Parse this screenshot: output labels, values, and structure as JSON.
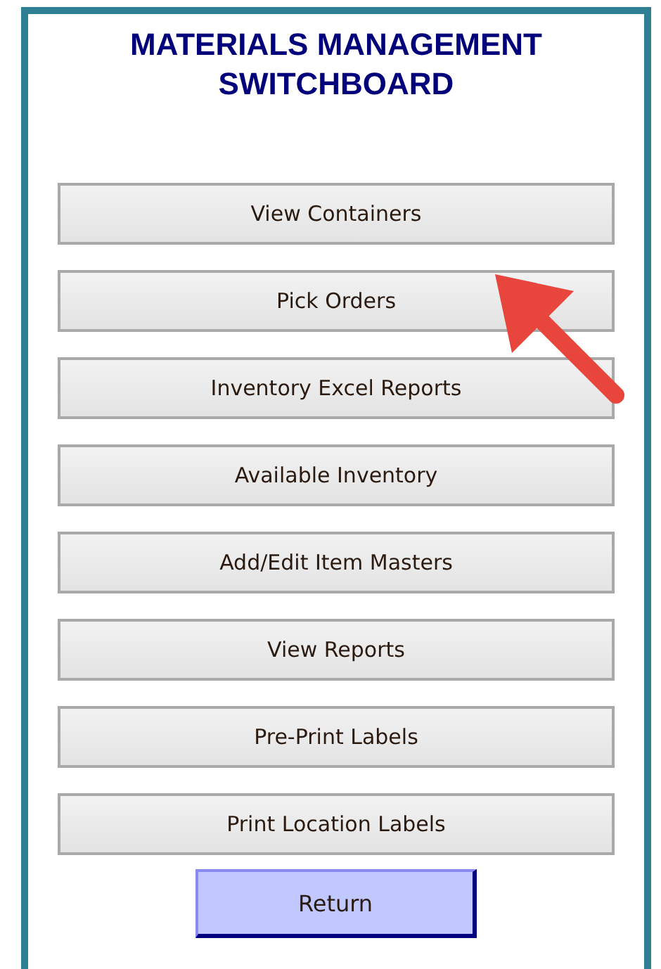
{
  "title": [
    "MATERIALS MANAGEMENT",
    "SWITCHBOARD"
  ],
  "buttons": [
    {
      "label": "View Containers"
    },
    {
      "label": "Pick Orders"
    },
    {
      "label": "Inventory Excel Reports"
    },
    {
      "label": "Available Inventory"
    },
    {
      "label": "Add/Edit Item Masters"
    },
    {
      "label": "View Reports"
    },
    {
      "label": "Pre-Print Labels"
    },
    {
      "label": "Print Location Labels"
    }
  ],
  "return_button": {
    "label": "Return"
  }
}
